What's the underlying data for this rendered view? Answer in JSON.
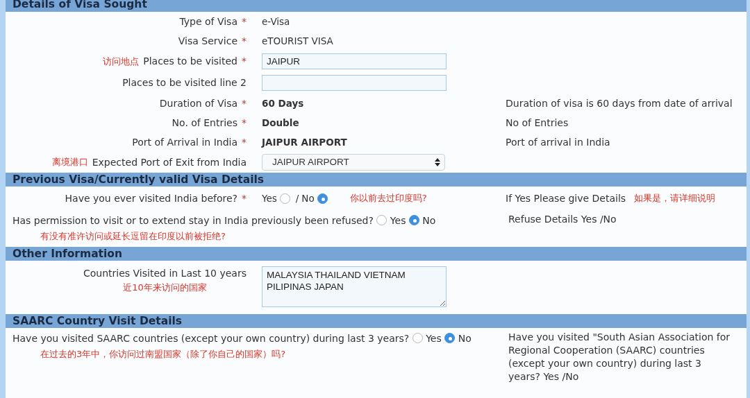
{
  "sections": [
    {
      "title": "Details of Visa Sought",
      "rows": [
        {
          "kind": "text",
          "label": "Type of Visa",
          "marker": "*",
          "value": "e-Visa",
          "bold": false
        },
        {
          "kind": "text",
          "label": "Visa Service",
          "marker": "*",
          "value": "eTOURIST VISA",
          "bold": false
        },
        {
          "kind": "input",
          "note": "访问地点",
          "label": "Places to be visited",
          "marker": "*",
          "value": "JAIPUR"
        },
        {
          "kind": "input",
          "label": "Places to be visited line 2"
        },
        {
          "kind": "text",
          "label": "Duration of Visa",
          "marker": "*",
          "value": "60 Days",
          "bold": true,
          "help": "Duration of visa is 60 days from date of arrival"
        },
        {
          "kind": "text",
          "label": "No. of Entries",
          "marker": "*",
          "value": "Double",
          "bold": true,
          "help": "No of Entries"
        },
        {
          "kind": "text",
          "label": "Port of Arrival in India",
          "marker": "*",
          "value": "JAIPUR AIRPORT",
          "bold": true,
          "help": "Port of arrival in India"
        },
        {
          "kind": "select",
          "note": "离境港口",
          "label": "Expected Port of Exit from India",
          "value": "JAIPUR AIRPORT"
        }
      ]
    },
    {
      "title": "Previous Visa/Currently valid Visa Details",
      "rows": [
        {
          "kind": "radio-inline",
          "label": "Have you ever visited India before?",
          "marker": "*",
          "separator": "/",
          "options": [
            {
              "label": "Yes",
              "selected": false
            },
            {
              "label": "No",
              "selected": true
            }
          ],
          "note": "你以前去过印度吗?",
          "help": "If Yes Please give Details",
          "help_note": "如果是，请详细说明"
        },
        {
          "kind": "radio-wrap",
          "label": "Has permission to visit or to extend stay in India previously been refused?",
          "options": [
            {
              "label": "Yes",
              "selected": false
            },
            {
              "label": "No",
              "selected": true
            }
          ],
          "note": "有没有准许访问或延长逗留在印度以前被拒绝?",
          "help": "Refuse Details Yes /No"
        }
      ]
    },
    {
      "title": "Other Information",
      "rows": [
        {
          "kind": "textarea",
          "label": "Countries Visited in Last 10 years",
          "note": "近10年来访问的国家",
          "value": "MALAYSIA THAILAND VIETNAM PILIPINAS JAPAN"
        }
      ]
    },
    {
      "title": "SAARC Country Visit Details",
      "rows": [
        {
          "kind": "radio-wrap",
          "label": "Have you visited SAARC countries (except your own country) during last 3 years?",
          "options": [
            {
              "label": "Yes",
              "selected": false
            },
            {
              "label": "No",
              "selected": true
            }
          ],
          "note": "在过去的3年中，你访问过南盟国家（除了你自己的国家）吗?",
          "help": "Have you visited \"South Asian Association for Regional Cooperation (SAARC) countries (except your own country) during last 3 years? Yes /No"
        }
      ]
    }
  ]
}
